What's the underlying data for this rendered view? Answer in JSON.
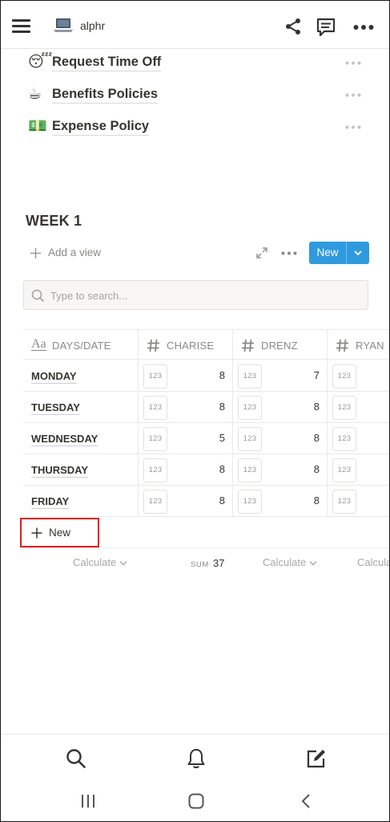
{
  "header": {
    "workspace_name": "alphr",
    "workspace_icon": "laptop-icon"
  },
  "pages": [
    {
      "emoji": "😴",
      "title": "Request Time Off"
    },
    {
      "emoji": "☕",
      "title": "Benefits Policies"
    },
    {
      "emoji": "💵",
      "title": "Expense Policy"
    }
  ],
  "database": {
    "title": "WEEK 1",
    "add_view_label": "Add a view",
    "new_button_label": "New",
    "search_placeholder": "Type to search...",
    "columns": [
      "DAYS/DATE",
      "CHARISE",
      "DRENZ",
      "RYAN"
    ],
    "number_icon_text": "123",
    "rows": [
      {
        "day": "MONDAY",
        "charise": "8",
        "drenz": "7"
      },
      {
        "day": "TUESDAY",
        "charise": "8",
        "drenz": "8"
      },
      {
        "day": "WEDNESDAY",
        "charise": "5",
        "drenz": "8"
      },
      {
        "day": "THURSDAY",
        "charise": "8",
        "drenz": "8"
      },
      {
        "day": "FRIDAY",
        "charise": "8",
        "drenz": "8"
      }
    ],
    "new_row_label": "New",
    "footer": {
      "calculate_label": "Calculate",
      "calculate_label_clipped": "Calcula",
      "sum_label": "SUM",
      "sum_value": "37"
    }
  },
  "colors": {
    "accent_blue": "#2f9bde",
    "highlight_red": "#e3191d",
    "text": "#37352f",
    "muted": "#8a8986"
  }
}
